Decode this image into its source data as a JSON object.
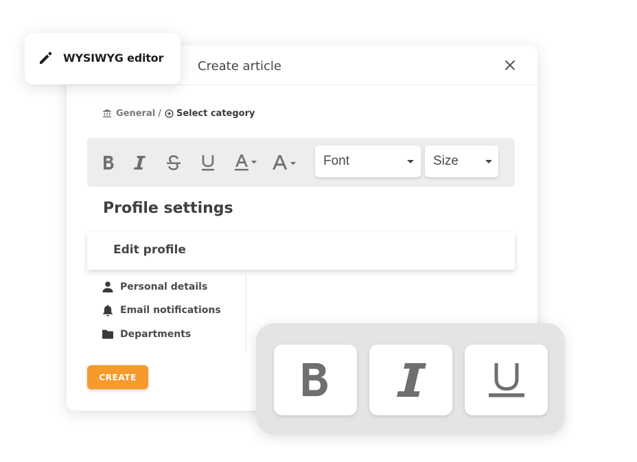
{
  "tag": {
    "label": "WYSIWYG editor",
    "icon": "pencil-icon"
  },
  "dialog": {
    "title": "Create article",
    "close_icon": "close-icon"
  },
  "breadcrumb": {
    "root": "General",
    "separator": "/",
    "action": "Select category"
  },
  "toolbar": {
    "font_select": "Font",
    "size_select": "Size",
    "buttons": [
      "bold-icon",
      "italic-icon",
      "strikethrough-icon",
      "underline-icon",
      "font-color-icon",
      "font-size-icon"
    ]
  },
  "section": {
    "title": "Profile settings"
  },
  "edit_profile": {
    "label": "Edit profile"
  },
  "menu": {
    "items": [
      {
        "label": "Personal details",
        "icon": "person-icon"
      },
      {
        "label": "Email notifications",
        "icon": "bell-icon"
      },
      {
        "label": "Departments",
        "icon": "folder-icon"
      }
    ]
  },
  "create_button": {
    "label": "CREATE"
  },
  "colors": {
    "accent": "#f79a2e",
    "toolbar_bg": "#ededed",
    "panel_bg": "#e4e4e4",
    "icon": "#6f6f6f"
  }
}
